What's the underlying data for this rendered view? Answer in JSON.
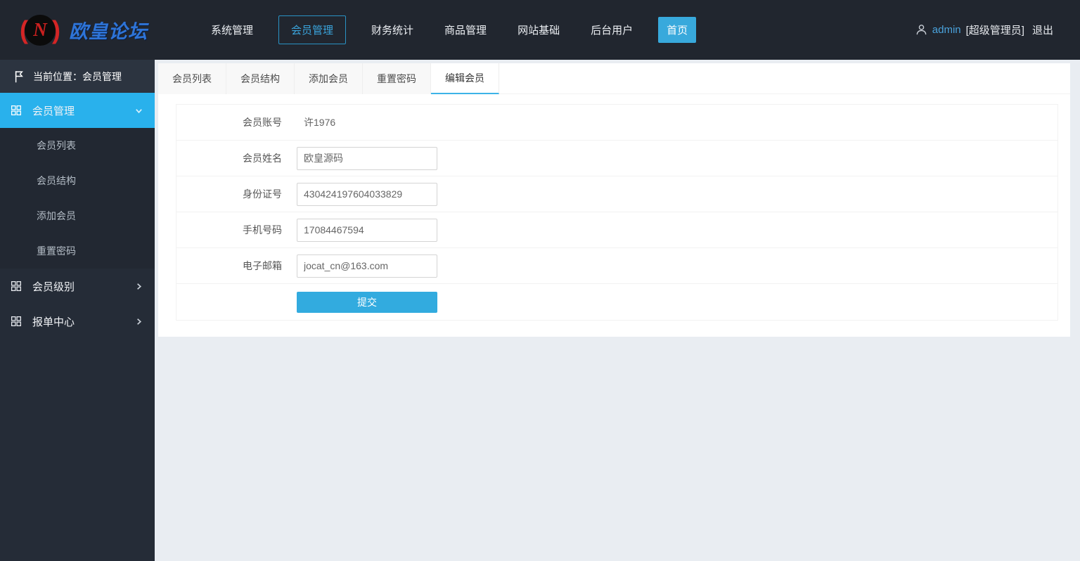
{
  "colors": {
    "topbar_bg": "#21262f",
    "sidebar_bg": "#252c37",
    "location_row_bg": "#2c3440",
    "sidebar_active_bg": "#29b1ec",
    "accent_button_blue": "#32abdf",
    "home_button_blue": "#38a9dc",
    "tab_active_underline": "#3db3e8",
    "nav_outlined_border": "#2a93c5",
    "admin_link_blue": "#4aa3dd",
    "logo_text_blue": "#2e74d8",
    "logo_mark_red": "#d42525",
    "content_bg": "#e9edf2"
  },
  "brand": {
    "name": "欧皇论坛",
    "logo_letter": "N",
    "paren_left": "(",
    "paren_right": ")"
  },
  "topnav": {
    "items": [
      {
        "label": "系统管理",
        "state": "normal"
      },
      {
        "label": "会员管理",
        "state": "outlined"
      },
      {
        "label": "财务统计",
        "state": "normal"
      },
      {
        "label": "商品管理",
        "state": "normal"
      },
      {
        "label": "网站基础",
        "state": "normal"
      },
      {
        "label": "后台用户",
        "state": "normal"
      },
      {
        "label": "首页",
        "state": "button"
      }
    ]
  },
  "user": {
    "name": "admin",
    "role": "[超级管理员]",
    "logout_label": "退出"
  },
  "sidebar": {
    "location_label": "当前位置：会员管理",
    "groups": [
      {
        "label": "会员管理",
        "expanded": true,
        "children": [
          "会员列表",
          "会员结构",
          "添加会员",
          "重置密码"
        ]
      },
      {
        "label": "会员级别",
        "expanded": false
      },
      {
        "label": "报单中心",
        "expanded": false
      }
    ]
  },
  "tabs": {
    "items": [
      {
        "label": "会员列表",
        "active": false
      },
      {
        "label": "会员结构",
        "active": false
      },
      {
        "label": "添加会员",
        "active": false
      },
      {
        "label": "重置密码",
        "active": false
      },
      {
        "label": "编辑会员",
        "active": true
      }
    ]
  },
  "form": {
    "fields": [
      {
        "label": "会员账号",
        "type": "static",
        "value": "许1976"
      },
      {
        "label": "会员姓名",
        "type": "input",
        "value": "欧皇源码"
      },
      {
        "label": "身份证号",
        "type": "input",
        "value": "430424197604033829"
      },
      {
        "label": "手机号码",
        "type": "input",
        "value": "17084467594"
      },
      {
        "label": "电子邮箱",
        "type": "input",
        "value": "jocat_cn@163.com"
      }
    ],
    "submit_label": "提交"
  }
}
